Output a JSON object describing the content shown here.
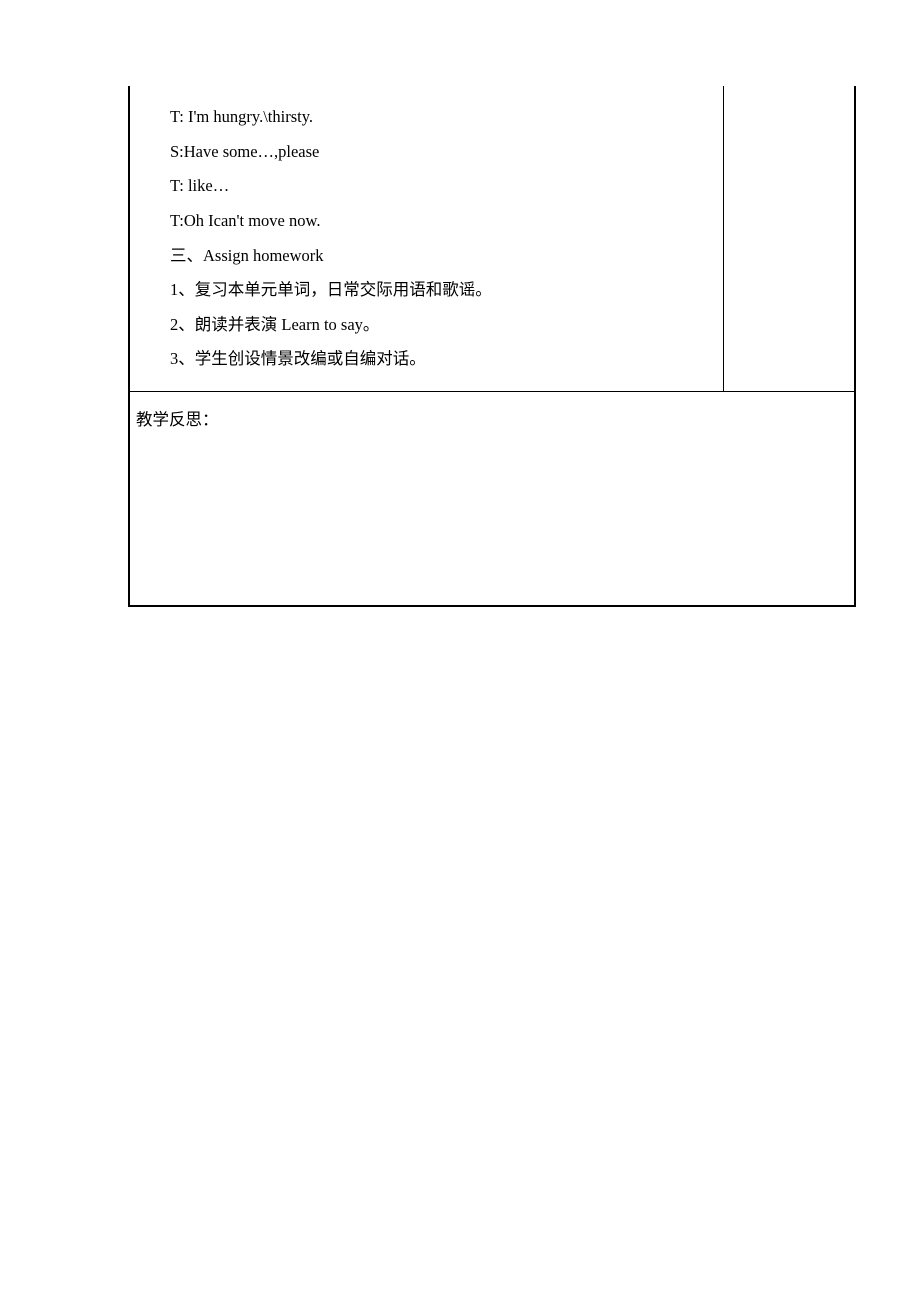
{
  "content": {
    "lines": [
      "T:  I'm  hungry.\\thirsty.",
      "S:Have  some…,please",
      "T:  like…",
      "T:Oh  Ican't  move  now.",
      "三、Assign  homework",
      "1、复习本单元单词，日常交际用语和歌谣。",
      "2、朗读并表演 Learn  to  say。",
      "3、学生创设情景改编或自编对话。"
    ]
  },
  "reflection": {
    "label": "教学反思："
  }
}
